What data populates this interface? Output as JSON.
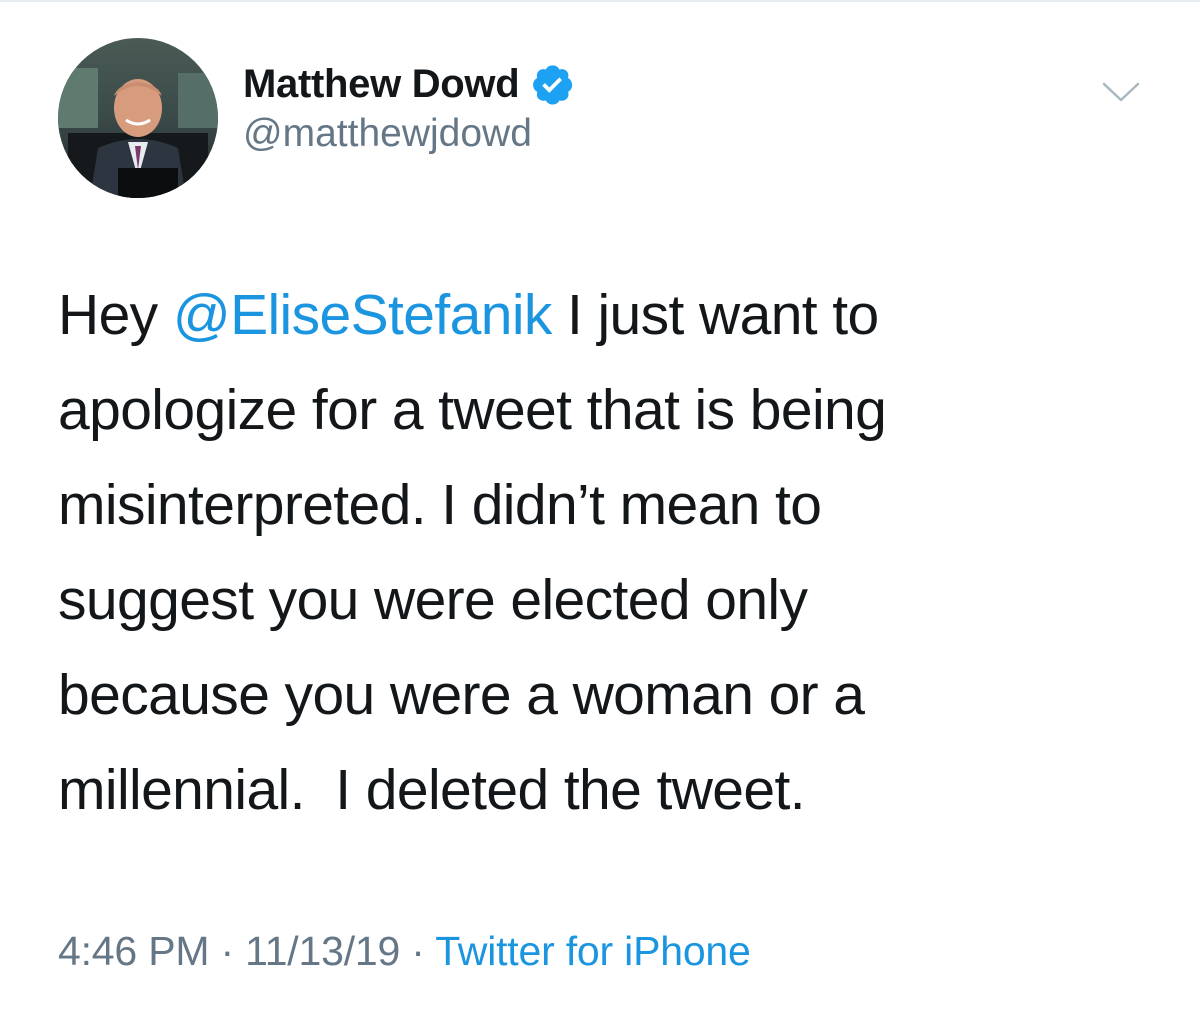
{
  "author": {
    "display_name": "Matthew Dowd",
    "handle": "@matthewjdowd",
    "verified": true,
    "avatar_icon": "profile-photo"
  },
  "tweet": {
    "line1_prefix": "Hey ",
    "mention": "@EliseStefanik",
    "line1_suffix": " I just want to",
    "line2": "apologize for a tweet that is being",
    "line3": "misinterpreted. I didn’t mean to",
    "line4": "suggest you were elected only",
    "line5": "because you were a woman or a",
    "line6": "millennial.  I deleted the tweet."
  },
  "meta": {
    "time": "4:46 PM",
    "separator": " · ",
    "date": "11/13/19",
    "source": "Twitter for iPhone"
  },
  "icons": {
    "verified": "verified-badge-icon",
    "caret": "chevron-down-icon"
  },
  "colors": {
    "link_blue": "#1b95e0",
    "verified_blue": "#1da1f2",
    "text": "#14171a",
    "secondary": "#657786"
  }
}
